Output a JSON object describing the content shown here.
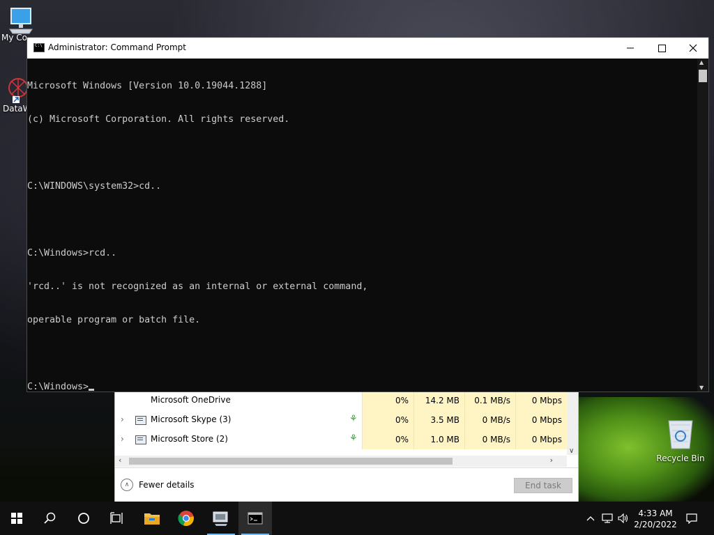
{
  "desktop": {
    "icons": [
      {
        "label": "My Co",
        "icon": "computer-icon"
      },
      {
        "label": "DataW",
        "icon": "datawrapper-icon"
      },
      {
        "label": "Recycle Bin",
        "icon": "recycle-bin-icon"
      }
    ]
  },
  "cmd": {
    "title": "Administrator: Command Prompt",
    "lines": [
      "Microsoft Windows [Version 10.0.19044.1288]",
      "(c) Microsoft Corporation. All rights reserved.",
      "",
      "C:\\WINDOWS\\system32>cd..",
      "",
      "C:\\Windows>rcd..",
      "'rcd..' is not recognized as an internal or external command,",
      "operable program or batch file.",
      "",
      "C:\\Windows>"
    ],
    "background": "#0c0c0c",
    "text_color": "#cccccc"
  },
  "task_manager": {
    "rows": [
      {
        "name": "Microsoft OneDrive",
        "cpu": "0%",
        "memory": "14.2 MB",
        "disk": "0.1 MB/s",
        "network": "0 Mbps",
        "has_expander": false,
        "suspended_leaf": false
      },
      {
        "name": "Microsoft Skype (3)",
        "cpu": "0%",
        "memory": "3.5 MB",
        "disk": "0 MB/s",
        "network": "0 Mbps",
        "has_expander": true,
        "suspended_leaf": true
      },
      {
        "name": "Microsoft Store (2)",
        "cpu": "0%",
        "memory": "1.0 MB",
        "disk": "0 MB/s",
        "network": "0 Mbps",
        "has_expander": true,
        "suspended_leaf": true
      }
    ],
    "fewer_details": "Fewer details",
    "end_task": "End task"
  },
  "taskbar": {
    "items": [
      "start-icon",
      "search-icon",
      "cortana-icon",
      "task-view-icon",
      "file-explorer-icon",
      "chrome-icon",
      "remote-desktop-icon",
      "command-prompt-icon"
    ],
    "time": "4:33 AM",
    "date": "2/20/2022"
  }
}
